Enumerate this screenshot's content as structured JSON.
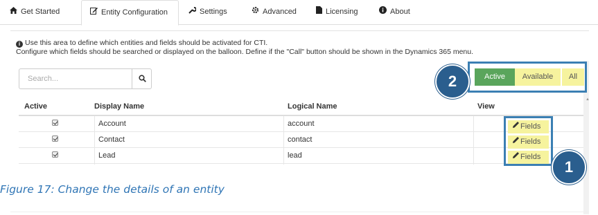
{
  "tabs": [
    {
      "label": "Get Started",
      "icon": "home-icon"
    },
    {
      "label": "Entity Configuration",
      "icon": "edit-icon"
    },
    {
      "label": "Settings",
      "icon": "wrench-icon"
    },
    {
      "label": "Advanced",
      "icon": "cog-icon"
    },
    {
      "label": "Licensing",
      "icon": "document-icon"
    },
    {
      "label": "About",
      "icon": "info-icon"
    }
  ],
  "active_tab": "Entity Configuration",
  "info": {
    "line1": "Use this area to define which entities and fields should be activated for CTI.",
    "line2": "Configure which fields should be searched or displayed on the balloon. Define if the \"Call\" button should be shown in the Dynamics 365 menu."
  },
  "search": {
    "placeholder": "Search...",
    "value": ""
  },
  "filters": [
    {
      "label": "Active",
      "selected": true
    },
    {
      "label": "Available",
      "selected": false
    },
    {
      "label": "All",
      "selected": false
    }
  ],
  "table": {
    "headers": [
      "Active",
      "Display Name",
      "Logical Name",
      "View"
    ],
    "rows": [
      {
        "active": true,
        "display_name": "Account",
        "logical_name": "account",
        "view": "Fields"
      },
      {
        "active": true,
        "display_name": "Contact",
        "logical_name": "contact",
        "view": "Fields"
      },
      {
        "active": true,
        "display_name": "Lead",
        "logical_name": "lead",
        "view": "Fields"
      }
    ]
  },
  "callouts": [
    "1",
    "2"
  ],
  "caption": "Figure 17: Change the details of an entity",
  "colors": {
    "active_green": "#5aa55c",
    "highlight_yellow": "#f6f39e",
    "callout_blue": "#2a5e8e",
    "frame_blue": "#3b7fb3",
    "caption_blue": "#2f75b5"
  }
}
